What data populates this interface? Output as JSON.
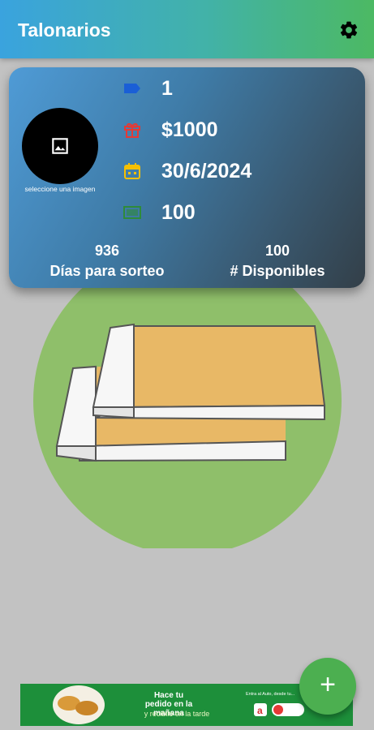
{
  "appbar": {
    "title": "Talonarios",
    "settings_icon": "gear-icon"
  },
  "card": {
    "avatar_label": "seleccione una imagen",
    "avatar_icon": "image-icon",
    "rows": [
      {
        "icon": "label-icon",
        "value": "1",
        "color": "#1a5fd6"
      },
      {
        "icon": "gift-icon",
        "value": "$1000",
        "color": "#e53935"
      },
      {
        "icon": "calendar-icon",
        "value": "30/6/2024",
        "color": "#f6c000"
      },
      {
        "icon": "money-icon",
        "value": "100",
        "color": "#2e8b3a"
      }
    ],
    "stats": [
      {
        "value": "936",
        "label": "Días para sorteo"
      },
      {
        "value": "100",
        "label": "# Disponibles"
      }
    ]
  },
  "fab": {
    "icon": "plus-icon",
    "label": "+"
  },
  "ad": {
    "headline": "Hace tu pedido en la mañana",
    "subline": "y recibilo en la tarde",
    "small": "Entra al Auto, desde tu..."
  },
  "colors": {
    "accent": "#4caf50",
    "background": "#c2c2c2"
  }
}
